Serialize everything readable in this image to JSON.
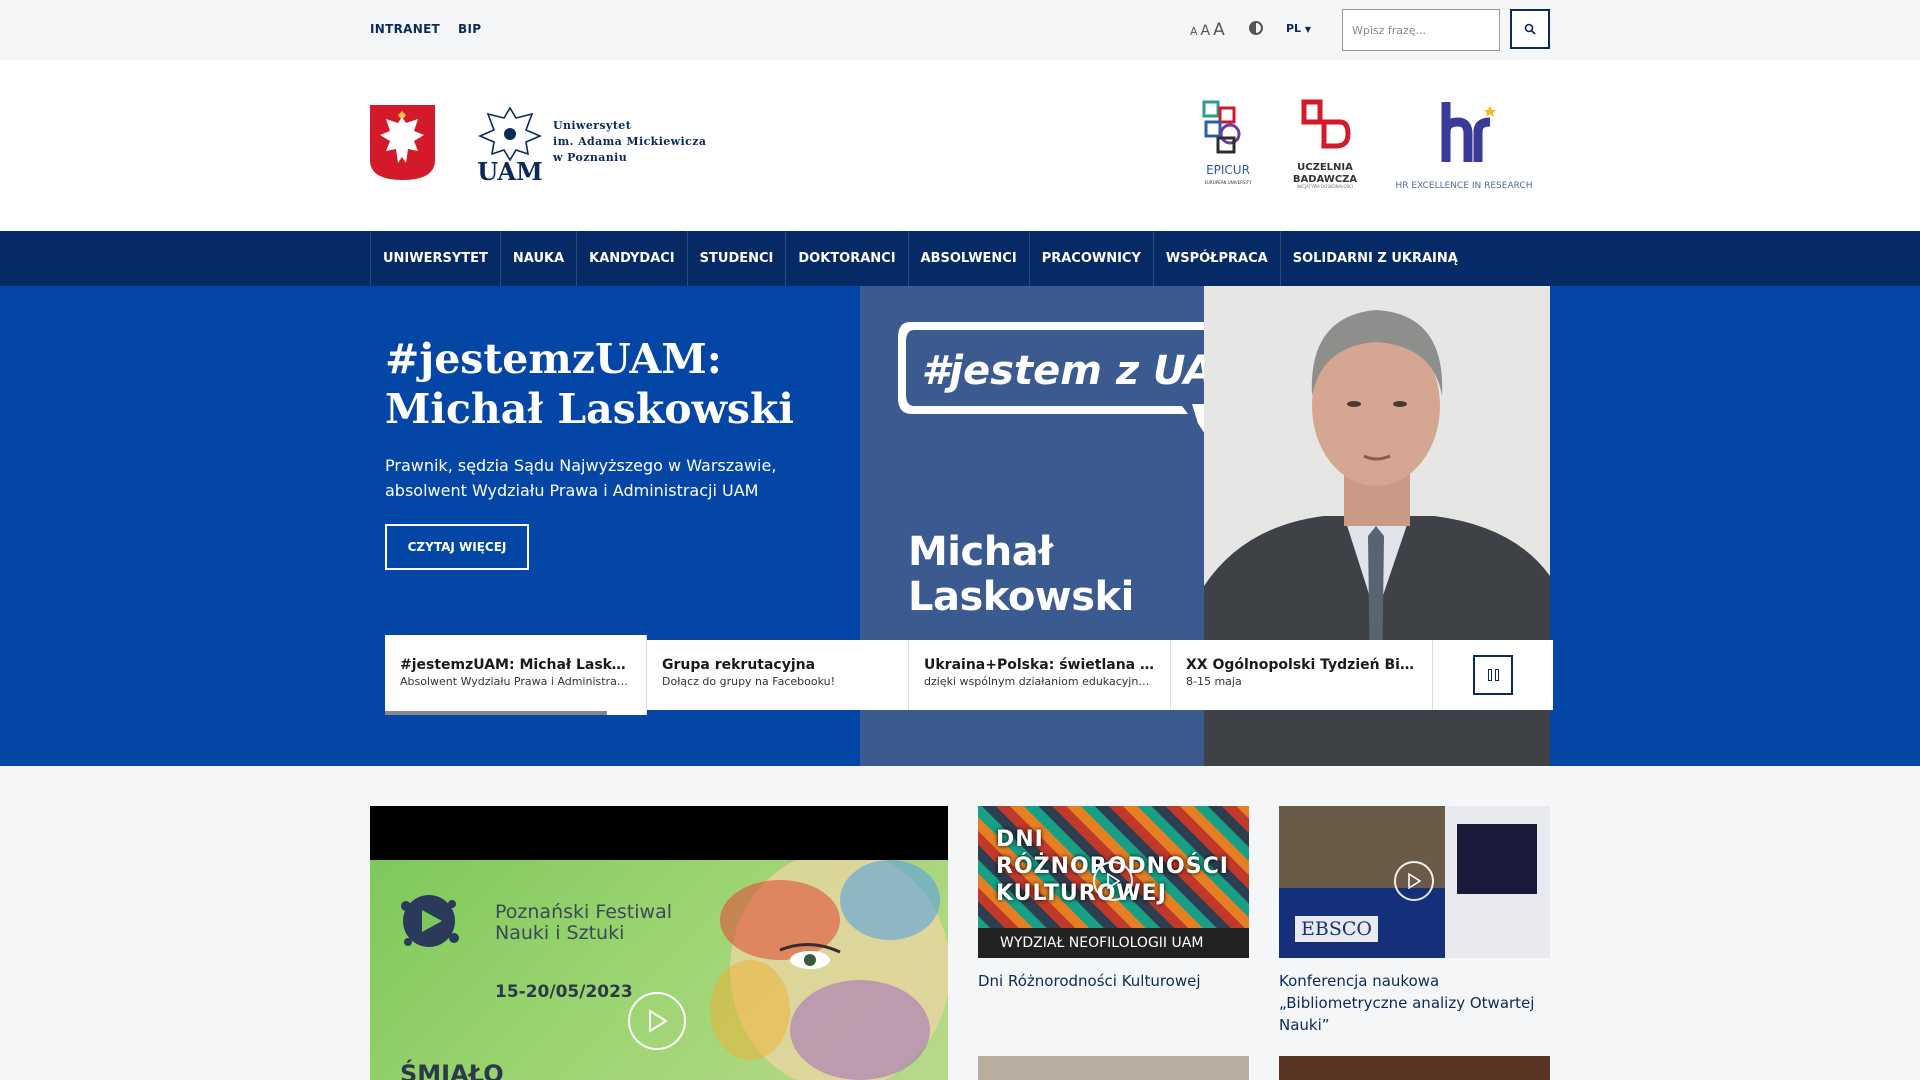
{
  "topbar": {
    "links": [
      "INTRANET",
      "BIP"
    ],
    "font_sizes": [
      "A",
      "A",
      "A"
    ],
    "language": "PL",
    "search_placeholder": "Wpisz frazę..."
  },
  "header": {
    "university_name_lines": [
      "Uniwersytet",
      "im. Adama Mickiewicza",
      "w Poznaniu"
    ],
    "partner_logos": [
      {
        "name": "EPICUR",
        "sub": "EUROPEAN UNIVERSITY"
      },
      {
        "name": "UCZELNIA BADAWCZA",
        "sub": "INICJATYWA DOSKONAŁOŚCI"
      },
      {
        "name": "HR EXCELLENCE IN RESEARCH"
      }
    ]
  },
  "nav": {
    "items": [
      "UNIWERSYTET",
      "NAUKA",
      "KANDYDACI",
      "STUDENCI",
      "DOKTORANCI",
      "ABSOLWENCI",
      "PRACOWNICY",
      "WSPÓŁPRACA",
      "SOLIDARNI Z UKRAINĄ"
    ]
  },
  "hero": {
    "title": "#jestemzUAM: Michał Laskowski",
    "description": "Prawnik, sędzia Sądu Najwyższego w Warszawie, absolwent Wydziału Prawa i Administracji UAM",
    "button": "CZYTAJ WIĘCEJ",
    "image_hashtag": "#jestem z UAM",
    "image_name_lines": [
      "Michał",
      "Laskowski"
    ],
    "tabs": [
      {
        "title": "#jestemzUAM: Michał Laskowski",
        "subtitle": "Absolwent Wydziału Prawa i Administracji UAM",
        "progress": 0.85
      },
      {
        "title": "Grupa rekrutacyjna",
        "subtitle": "Dołącz do grupy na Facebooku!"
      },
      {
        "title": "Ukraina+Polska: świetlana przyszłość",
        "subtitle": "dzięki wspólnym działaniom edukacyjnym"
      },
      {
        "title": "XX Ogólnopolski Tydzień Bibliotek",
        "subtitle": "8-15 maja"
      }
    ]
  },
  "main_video": {
    "festival_lines": [
      "Poznański Festiwal",
      "Nauki i Sztuki"
    ],
    "date": "15-20/05/2023",
    "tagline": "ŚMIAŁO"
  },
  "cards": [
    {
      "caption": "Dni Różnorodności Kulturowej",
      "thumb_lines": [
        "DNI",
        "RÓŻNORODNOŚCI",
        "KULTUROWEJ"
      ],
      "thumb_footer": "WYDZIAŁ NEOFILOLOGII UAM"
    },
    {
      "caption": "Konferencja naukowa „Bibliometryczne analizy Otwartej Nauki”",
      "thumb_label": "EBSCO"
    }
  ],
  "colors": {
    "navy": "#062a66",
    "hero_blue": "#0446a6",
    "hero_panel": "#3a5a90",
    "accent_red": "#d4192b"
  }
}
